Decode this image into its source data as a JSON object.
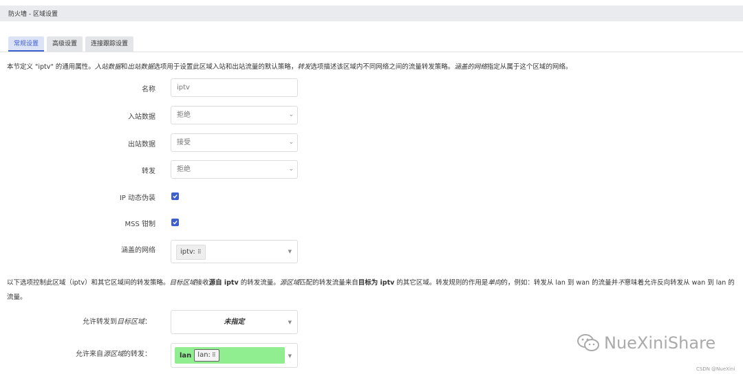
{
  "header": {
    "title": "防火墙 - 区域设置"
  },
  "tabs": [
    {
      "label": "常规设置",
      "active": true
    },
    {
      "label": "高级设置",
      "active": false
    },
    {
      "label": "连接跟踪设置",
      "active": false
    }
  ],
  "description": {
    "part1": "本节定义 \"iptv\" 的通用属性。",
    "part2": "入站数据",
    "part3": "和",
    "part4": "出站数据",
    "part5": "选项用于设置此区域入站和出站流量的默认策略，",
    "part6": "转发",
    "part7": "选项描述该区域内不同网络之间的流量转发策略。",
    "part8": "涵盖的网络",
    "part9": "指定从属于这个区域的网络。"
  },
  "form": {
    "name": {
      "label": "名称",
      "value": "iptv"
    },
    "input": {
      "label": "入站数据",
      "value": "拒绝"
    },
    "output": {
      "label": "出站数据",
      "value": "接受"
    },
    "forward": {
      "label": "转发",
      "value": "拒绝"
    },
    "masq": {
      "label": "IP 动态伪装",
      "checked": true
    },
    "mss": {
      "label": "MSS 钳制",
      "checked": true
    },
    "networks": {
      "label": "涵盖的网络",
      "tag": "iptv:"
    }
  },
  "description2": {
    "s1": "以下选项控制此区域（iptv）和其它区域间的转发策略。",
    "s2": "目标区域",
    "s3": "接收",
    "s4": "源自 iptv",
    "s5": " 的转发流量。",
    "s6": "源区域",
    "s7": "匹配的转发流量来自",
    "s8": "目标为 iptv",
    "s9": " 的其它区域。转发规则的作用是",
    "s10": "单向",
    "s11": "的，例如：转发从 lan 到 wan 的流量并",
    "s12": "不",
    "s13": "意味着允许反向转发从 wan 到 lan 的流量。"
  },
  "forwarding": {
    "dest": {
      "label_a": "允许转发到",
      "label_b": "目标区域",
      "label_c": "：",
      "value": "未指定"
    },
    "src": {
      "label_a": "允许来自",
      "label_b": "源区域",
      "label_c": "的转发：",
      "zone": "lan",
      "net": "lan:"
    }
  },
  "watermark": {
    "text": "NueXiniShare",
    "credit": "CSDN @NueXini"
  },
  "colors": {
    "accent": "#3d5fcf",
    "lan_zone": "#90ee90",
    "header_bg": "#e9ebee"
  },
  "icons": {
    "network": "network-icon",
    "dropdown": "chevron-down-icon",
    "wechat": "wechat-icon"
  }
}
